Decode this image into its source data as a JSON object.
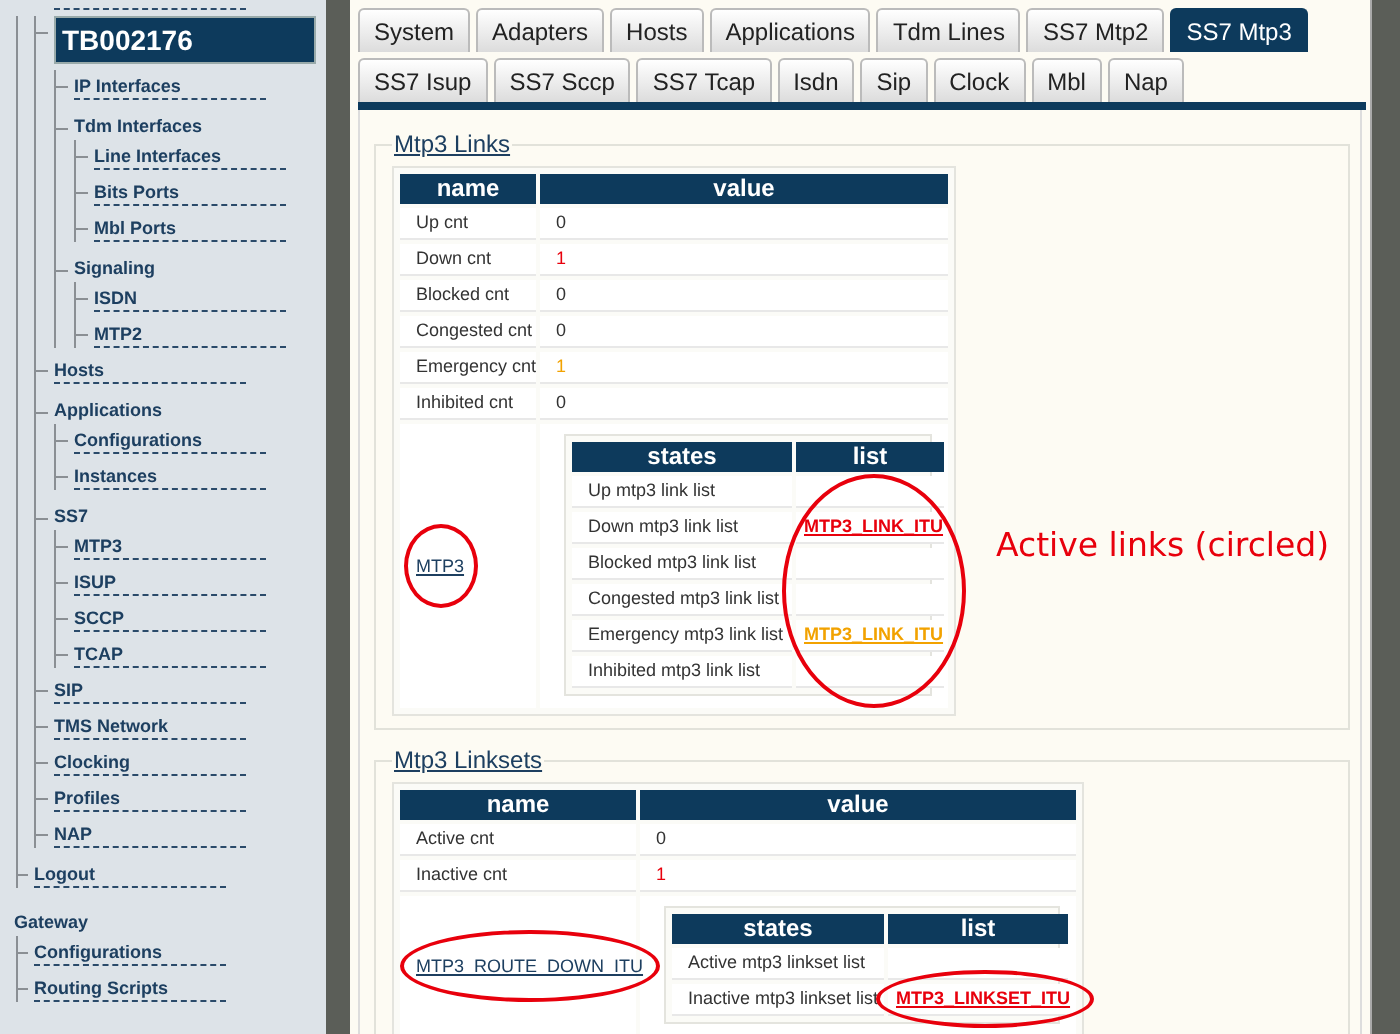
{
  "sidebar": {
    "items": [
      {
        "label": "TB002176",
        "selected": true,
        "children": [
          {
            "label": "IP Interfaces",
            "selected": false
          },
          {
            "label": "Tdm Interfaces",
            "selected": false,
            "children": [
              {
                "label": "Line Interfaces",
                "selected": false
              },
              {
                "label": "Bits Ports",
                "selected": false
              },
              {
                "label": "Mbl Ports",
                "selected": false
              }
            ]
          },
          {
            "label": "Signaling",
            "selected": false,
            "children": [
              {
                "label": "ISDN",
                "selected": false
              },
              {
                "label": "MTP2",
                "selected": false
              }
            ]
          }
        ]
      },
      {
        "label": "Hosts",
        "selected": false
      },
      {
        "label": "Applications",
        "selected": false,
        "children": [
          {
            "label": "Configurations",
            "selected": false
          },
          {
            "label": "Instances",
            "selected": false
          }
        ]
      },
      {
        "label": "SS7",
        "selected": false,
        "children": [
          {
            "label": "MTP3",
            "selected": false
          },
          {
            "label": "ISUP",
            "selected": false
          },
          {
            "label": "SCCP",
            "selected": false
          },
          {
            "label": "TCAP",
            "selected": false
          }
        ]
      },
      {
        "label": "SIP",
        "selected": false
      },
      {
        "label": "TMS Network",
        "selected": false
      },
      {
        "label": "Clocking",
        "selected": false
      },
      {
        "label": "Profiles",
        "selected": false
      },
      {
        "label": "NAP",
        "selected": false
      }
    ],
    "logout": "Logout",
    "gateway": {
      "title": "Gateway",
      "items": [
        {
          "label": "Configurations",
          "selected": false
        },
        {
          "label": "Routing Scripts",
          "selected": false
        }
      ]
    }
  },
  "tabs": [
    {
      "label": "System",
      "selected": false
    },
    {
      "label": "Adapters",
      "selected": false
    },
    {
      "label": "Hosts",
      "selected": false
    },
    {
      "label": "Applications",
      "selected": false
    },
    {
      "label": "Tdm Lines",
      "selected": false
    },
    {
      "label": "SS7 Mtp2",
      "selected": false
    },
    {
      "label": "SS7 Mtp3",
      "selected": true
    },
    {
      "label": "SS7 Isup",
      "selected": false
    },
    {
      "label": "SS7 Sccp",
      "selected": false
    },
    {
      "label": "SS7 Tcap",
      "selected": false
    },
    {
      "label": "Isdn",
      "selected": false
    },
    {
      "label": "Sip",
      "selected": false
    },
    {
      "label": "Clock",
      "selected": false
    },
    {
      "label": "Mbl",
      "selected": false
    },
    {
      "label": "Nap",
      "selected": false
    }
  ],
  "sections": [
    {
      "title": "Mtp3 Links",
      "columns": [
        "name",
        "value"
      ],
      "rows": [
        {
          "name": "Up cnt",
          "value": "0",
          "color": "#333333"
        },
        {
          "name": "Down cnt",
          "value": "1",
          "color": "#e8000c"
        },
        {
          "name": "Blocked cnt",
          "value": "0",
          "color": "#333333"
        },
        {
          "name": "Congested cnt",
          "value": "0",
          "color": "#333333"
        },
        {
          "name": "Emergency cnt",
          "value": "1",
          "color": "#f2a200"
        },
        {
          "name": "Inhibited cnt",
          "value": "0",
          "color": "#333333"
        }
      ],
      "detail": {
        "name": "MTP3",
        "circled": true,
        "columns": [
          "states",
          "list"
        ],
        "list_circled": true,
        "rows": [
          {
            "state": "Up mtp3 link list"
          },
          {
            "state": "Down mtp3 link list",
            "link": "MTP3_LINK_ITU",
            "color": "#e8000c"
          },
          {
            "state": "Blocked mtp3 link list"
          },
          {
            "state": "Congested mtp3 link list"
          },
          {
            "state": "Emergency mtp3 link list",
            "link": "MTP3_LINK_ITU",
            "color": "#f2a200"
          },
          {
            "state": "Inhibited mtp3 link list"
          }
        ]
      },
      "annotation": "Active links (circled)"
    },
    {
      "title": "Mtp3 Linksets",
      "columns": [
        "name",
        "value"
      ],
      "rows": [
        {
          "name": "Active cnt",
          "value": "0",
          "color": "#333333"
        },
        {
          "name": "Inactive cnt",
          "value": "1",
          "color": "#e8000c"
        }
      ],
      "detail": {
        "name": "MTP3_ROUTE_DOWN_ITU",
        "circled": true,
        "columns": [
          "states",
          "list"
        ],
        "rows": [
          {
            "state": "Active mtp3 linkset list"
          },
          {
            "state": "Inactive mtp3 linkset list",
            "link": "MTP3_LINKSET_ITU",
            "color": "#e8000c",
            "circled": true
          }
        ]
      }
    }
  ]
}
